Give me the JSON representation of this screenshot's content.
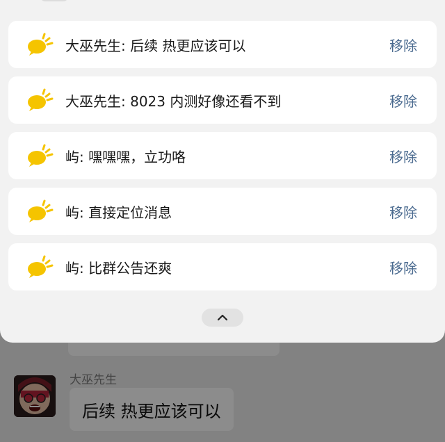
{
  "notifications": [
    {
      "sender": "大巫先生",
      "separator": ": ",
      "text": "后续 热更应该可以",
      "action": "移除"
    },
    {
      "sender": "大巫先生",
      "separator": ": ",
      "text": "8023 内测好像还看不到",
      "action": "移除"
    },
    {
      "sender": "屿",
      "separator": ": ",
      "text": "嘿嘿嘿，立功咯",
      "action": "移除"
    },
    {
      "sender": "屿",
      "separator": ": ",
      "text": "直接定位消息",
      "action": "移除"
    },
    {
      "sender": "屿",
      "separator": ": ",
      "text": "比群公告还爽",
      "action": "移除"
    }
  ],
  "chat": {
    "sender_name": "大巫先生",
    "message": "后续 热更应该可以"
  },
  "icons": {
    "notification_icon": "message-bubble-icon",
    "collapse": "chevron-up-icon"
  },
  "colors": {
    "icon_yellow": "#f5c400",
    "remove_link": "#4a6a8f",
    "card_bg": "#ffffff",
    "panel_bg": "#f2f2f2"
  }
}
